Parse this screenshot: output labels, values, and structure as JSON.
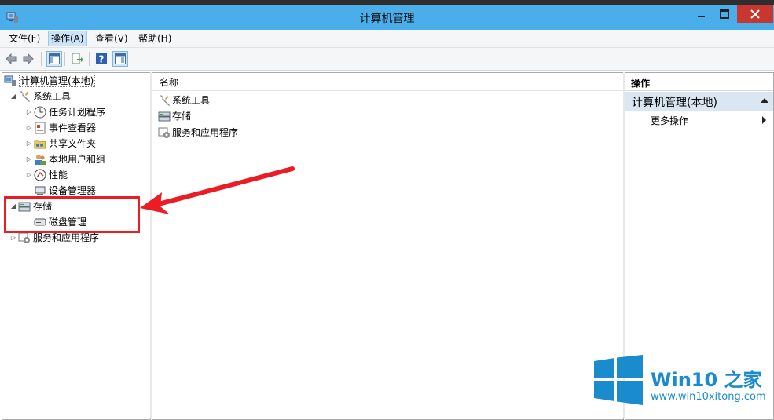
{
  "window": {
    "title": "计算机管理"
  },
  "menu": [
    {
      "label": "文件(F)"
    },
    {
      "label": "操作(A)"
    },
    {
      "label": "查看(V)"
    },
    {
      "label": "帮助(H)"
    }
  ],
  "toolbar": {
    "icons": [
      "back-arrow-icon",
      "forward-arrow-icon",
      "show-tree-icon",
      "export-list-icon",
      "help-icon",
      "show-action-pane-icon"
    ]
  },
  "tree": {
    "root": "计算机管理(本地)",
    "system_tools": "系统工具",
    "task_scheduler": "任务计划程序",
    "event_viewer": "事件查看器",
    "shared_folders": "共享文件夹",
    "local_users": "本地用户和组",
    "performance": "性能",
    "device_manager": "设备管理器",
    "storage": "存储",
    "disk_management": "磁盘管理",
    "services_apps": "服务和应用程序"
  },
  "list": {
    "column_name": "名称",
    "items": [
      "系统工具",
      "存储",
      "服务和应用程序"
    ]
  },
  "actions": {
    "title": "操作",
    "section": "计算机管理(本地)",
    "more": "更多操作"
  },
  "watermark": {
    "brand": "Win10 之家",
    "url": "www.win10xitong.com"
  },
  "colors": {
    "titlebar": "#49aeea",
    "close": "#c7372f",
    "highlight": "#ec1c24",
    "action_section": "#dae6f1",
    "watermark": "#1a8ccd"
  }
}
